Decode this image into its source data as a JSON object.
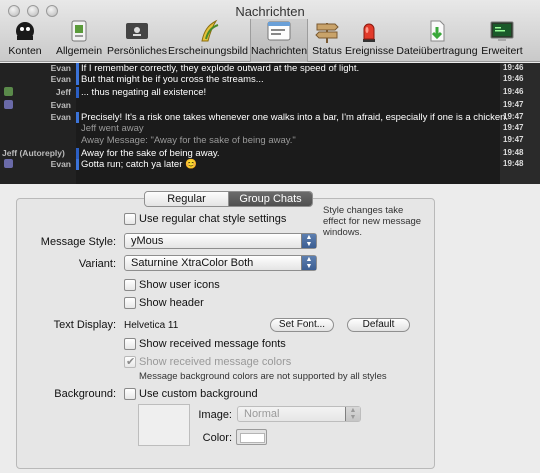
{
  "window": {
    "title": "Nachrichten"
  },
  "toolbar": {
    "items": [
      {
        "label": "Konten",
        "icon": "accounts-icon"
      },
      {
        "label": "Allgemein",
        "icon": "general-icon"
      },
      {
        "label": "Persönliches",
        "icon": "personal-icon"
      },
      {
        "label": "Erscheinungsbild",
        "icon": "appearance-icon"
      },
      {
        "label": "Nachrichten",
        "icon": "messages-icon"
      },
      {
        "label": "Status",
        "icon": "status-icon"
      },
      {
        "label": "Ereignisse",
        "icon": "events-icon"
      },
      {
        "label": "Dateiübertragung",
        "icon": "file-transfer-icon"
      },
      {
        "label": "Erweitert",
        "icon": "advanced-icon"
      }
    ],
    "selected": "Nachrichten"
  },
  "preview": {
    "lines": [
      {
        "sender": "Evan",
        "text": "If I remember correctly, they explode outward at the speed of light.",
        "time": "19:46",
        "bar": "#3b73d8",
        "kind": "msg"
      },
      {
        "sender": "Evan",
        "text": "But that might be if you cross the streams...",
        "time": "19:46",
        "bar": "#3b73d8",
        "kind": "msg"
      },
      {
        "sender": "Jeff",
        "text": "... thus negating all existence!",
        "time": "19:46",
        "bar": "#2b5fc4",
        "kind": "msg"
      },
      {
        "sender": "Evan",
        "text": "",
        "time": "19:47",
        "bar": "",
        "kind": "gap"
      },
      {
        "sender": "Evan",
        "text": "Precisely! It's a risk one takes whenever one walks into a bar, I'm afraid, especially if one is a chicken.",
        "time": "19:47",
        "bar": "#3b73d8",
        "kind": "msg"
      },
      {
        "sender": "",
        "text": "Jeff went away",
        "time": "19:47",
        "bar": "",
        "kind": "sys"
      },
      {
        "sender": "",
        "text": "Away Message: \"Away for the sake of being away.\"",
        "time": "19:47",
        "bar": "",
        "kind": "sys"
      },
      {
        "sender": "Jeff (Autoreply)",
        "text": "Away for the sake of being away.",
        "time": "19:48",
        "bar": "#2b5fc4",
        "kind": "msg"
      },
      {
        "sender": "Evan",
        "text": "Gotta run; catch ya later 😊",
        "time": "19:48",
        "bar": "#3b73d8",
        "kind": "msg"
      }
    ]
  },
  "tabs": {
    "regular": "Regular Chats",
    "group": "Group Chats",
    "selected": "Group Chats"
  },
  "form": {
    "use_regular_style": "Use regular chat style settings",
    "style_note": "Style changes take effect for new message windows.",
    "message_style_label": "Message Style:",
    "message_style_value": "yMous",
    "variant_label": "Variant:",
    "variant_value": "Saturnine XtraColor Both",
    "show_user_icons": "Show user icons",
    "show_header": "Show header",
    "text_display_label": "Text Display:",
    "text_display_value": "Helvetica 11",
    "set_font_button": "Set Font...",
    "default_button": "Default",
    "show_received_fonts": "Show received message fonts",
    "show_received_colors": "Show received message colors",
    "colors_note": "Message background colors are not supported by all styles",
    "background_label": "Background:",
    "use_custom_background": "Use custom background",
    "image_label": "Image:",
    "image_value": "Normal",
    "color_label": "Color:"
  }
}
